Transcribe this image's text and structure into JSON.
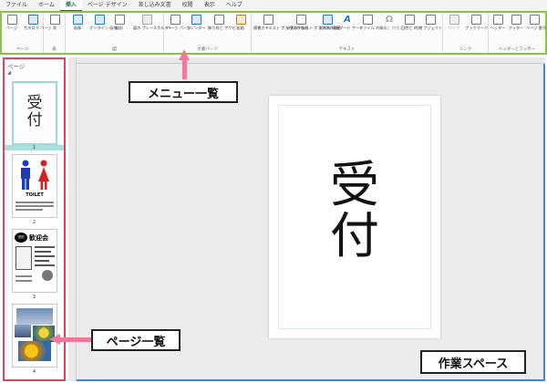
{
  "tabs": [
    "ファイル",
    "ホーム",
    "挿入",
    "ページ デザイン",
    "差し込み文書",
    "校閲",
    "表示",
    "ヘルプ"
  ],
  "active_tab": "挿入",
  "ribbon": {
    "groups": [
      {
        "label": "ページ",
        "buttons": [
          {
            "label": "ページ",
            "icon": "page-icon"
          },
          {
            "label": "カタログ ページ",
            "icon": "catalog-page-icon"
          }
        ]
      },
      {
        "label": "表",
        "buttons": [
          {
            "label": "表",
            "icon": "table-icon"
          }
        ]
      },
      {
        "label": "図",
        "buttons": [
          {
            "label": "画像",
            "icon": "picture-icon"
          },
          {
            "label": "オンライン 画像",
            "icon": "online-picture-icon"
          },
          {
            "label": "図形",
            "icon": "shapes-icon"
          },
          {
            "label": "図の プレースホルダー",
            "icon": "picture-placeholder-icon"
          }
        ]
      },
      {
        "label": "文書パーツ",
        "buttons": [
          {
            "label": "ページ パーツ",
            "icon": "page-parts-icon"
          },
          {
            "label": "カレンダー",
            "icon": "calendar-icon"
          },
          {
            "label": "飾り枠と アクセント",
            "icon": "borders-accents-icon"
          },
          {
            "label": "広告",
            "icon": "advertisement-icon"
          }
        ]
      },
      {
        "label": "テキスト",
        "buttons": [
          {
            "label": "横書きテキスト ボックスの描画",
            "icon": "horizontal-textbox-icon"
          },
          {
            "label": "縦書きテキスト ボックスの描画",
            "icon": "vertical-textbox-icon"
          },
          {
            "label": "勤務先 情報",
            "icon": "business-info-icon"
          },
          {
            "label": "ワード アート",
            "icon": "wordart-icon"
          },
          {
            "label": "ファイル の挿入",
            "icon": "insert-file-icon"
          },
          {
            "label": "記号と 特殊文字",
            "icon": "symbol-icon"
          },
          {
            "label": "日付と 時刻",
            "icon": "datetime-icon"
          },
          {
            "label": "オブジェクト",
            "icon": "object-icon"
          }
        ]
      },
      {
        "label": "リンク",
        "buttons": [
          {
            "label": "リンク",
            "icon": "link-icon"
          },
          {
            "label": "ブックマーク",
            "icon": "bookmark-icon"
          }
        ]
      },
      {
        "label": "ヘッダーとフッター",
        "buttons": [
          {
            "label": "ヘッダー",
            "icon": "header-icon"
          },
          {
            "label": "フッター",
            "icon": "footer-icon"
          },
          {
            "label": "ページ 番号",
            "icon": "page-number-icon"
          }
        ]
      }
    ]
  },
  "panel": {
    "title": "ページ",
    "pages": [
      {
        "number": "1",
        "text": "受付",
        "selected": true
      },
      {
        "number": "2",
        "text": "TOILET"
      },
      {
        "number": "3",
        "text": "歓迎会",
        "badge": "送別"
      },
      {
        "number": "4"
      }
    ]
  },
  "document": {
    "text": "受付"
  },
  "callouts": {
    "menu": "メニュー一覧",
    "pages": "ページ一覧",
    "workspace": "作業スペース"
  },
  "colors": {
    "ribbon_border": "#8bc34a",
    "panel_border": "#e0435a",
    "workspace_border": "#3f86d4",
    "arrow": "#f07a9b",
    "active_tab": "#217346"
  }
}
